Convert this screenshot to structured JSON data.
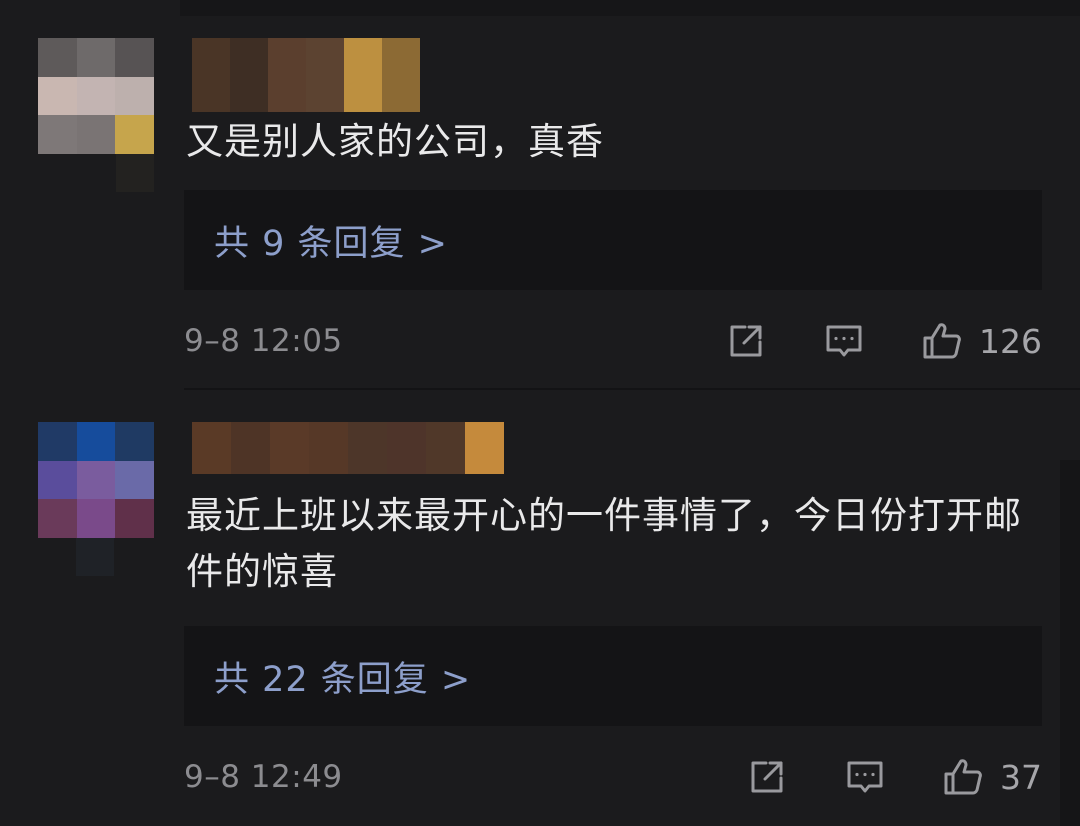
{
  "comments": [
    {
      "text": "又是别人家的公司，真香",
      "reply_link": "共 9 条回复 >",
      "timestamp": "9–8 12:05",
      "like_count": "126",
      "icons": [
        "share-icon",
        "comment-icon",
        "like-icon"
      ],
      "avatar_colors": [
        "#5e5a5a",
        "#6e6a6a",
        "#575354",
        "#c9b7b1",
        "#c3b4b2",
        "#bdb0ad",
        "#7e7878",
        "#7a7474",
        "#c6a54c"
      ],
      "username_colors": [
        "#4a3526",
        "#3e2e24",
        "#5b3f2e",
        "#5c4331",
        "#bd9040",
        "#8c6a34"
      ]
    },
    {
      "text": "最近上班以来最开心的一件事情了，今日份打开邮件的惊喜",
      "reply_link": "共 22 条回复 >",
      "timestamp": "9–8 12:49",
      "like_count": "37",
      "icons": [
        "share-icon",
        "comment-icon",
        "like-icon"
      ],
      "avatar_colors": [
        "#203a66",
        "#164c9c",
        "#1f3a63",
        "#5a4d9c",
        "#7a5c9e",
        "#6a6aa8",
        "#6a3a5a",
        "#7a4a8a",
        "#60304a"
      ],
      "username_colors": [
        "#5a3a26",
        "#4e3426",
        "#5a3a28",
        "#563827",
        "#4d3629",
        "#4e342a",
        "#503829",
        "#c58a3c"
      ]
    }
  ],
  "colors": {
    "background": "#1b1b1d",
    "reply_box": "#141416",
    "reply_link": "#8d9fcb",
    "text": "#e9e9ea",
    "meta": "#8c8c90"
  }
}
